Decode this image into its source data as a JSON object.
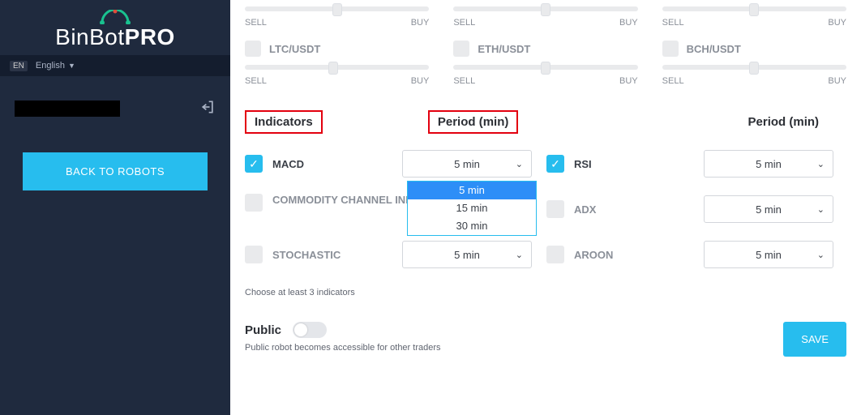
{
  "sidebar": {
    "brand_pre": "BinBot",
    "brand_suf": "PRO",
    "lang_code": "EN",
    "lang_label": "English",
    "back_label": "BACK TO ROBOTS"
  },
  "pairs_row1": [
    {
      "sell": "SELL",
      "buy": "BUY",
      "thumb": 50
    },
    {
      "sell": "SELL",
      "buy": "BUY",
      "thumb": 50
    },
    {
      "sell": "SELL",
      "buy": "BUY",
      "thumb": 50
    }
  ],
  "pairs_row2": [
    {
      "label": "LTC/USDT",
      "sell": "SELL",
      "buy": "BUY",
      "thumb": 48
    },
    {
      "label": "ETH/USDT",
      "sell": "SELL",
      "buy": "BUY",
      "thumb": 50
    },
    {
      "label": "BCH/USDT",
      "sell": "SELL",
      "buy": "BUY",
      "thumb": 50
    }
  ],
  "headers": {
    "indicators": "Indicators",
    "period_left": "Period (min)",
    "period_right": "Period (min)"
  },
  "indicators_left": [
    {
      "label": "MACD",
      "checked": true,
      "period": "5 min"
    },
    {
      "label": "COMMODITY CHANNEL INDEX",
      "checked": false,
      "period": ""
    },
    {
      "label": "STOCHASTIC",
      "checked": false,
      "period": "5 min"
    }
  ],
  "indicators_right": [
    {
      "label": "RSI",
      "checked": true,
      "period": "5 min"
    },
    {
      "label": "ADX",
      "checked": false,
      "period": "5 min"
    },
    {
      "label": "AROON",
      "checked": false,
      "period": "5 min"
    }
  ],
  "dropdown_options": [
    "5 min",
    "15 min",
    "30 min"
  ],
  "hint": "Choose at least 3 indicators",
  "public": {
    "label": "Public",
    "desc": "Public robot becomes accessible for other traders"
  },
  "save_label": "SAVE"
}
